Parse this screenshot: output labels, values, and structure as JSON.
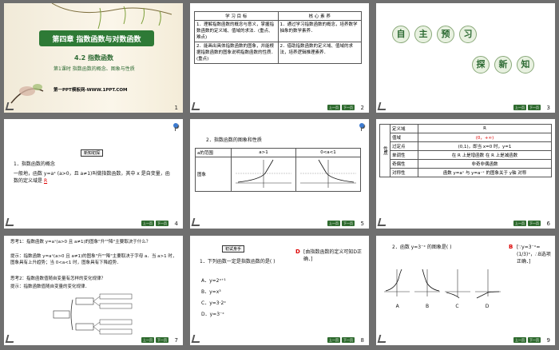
{
  "slide1": {
    "chapter_title": "第四章  指数函数与对数函数",
    "section": "4.2  指数函数",
    "lesson": "第1课时  指数函数的概念、图象与性质",
    "website": "第一PPT模板网-WWW.1PPT.COM",
    "number": "1"
  },
  "slide2": {
    "header_goal": "学 习 目 标",
    "header_core": "核 心 素 养",
    "row1_goal": "1．理解指数函数的概念与意义，掌握指数函数的定义域、值域的求法．(重点、难点)",
    "row1_core": "1．通过学习指数函数的概念，培养数学抽象的数学素养．",
    "row2_goal": "2．能画出具体指数函数的图象，并能根据指数函数的图象说明指数函数的性质．(重点)",
    "row2_core": "2．借助指数函数的定义域、值域的求法，培养逻辑推理素养．",
    "number": "2"
  },
  "slide3": {
    "chars1": [
      "自",
      "主",
      "预",
      "习"
    ],
    "chars2": [
      "探",
      "新",
      "知"
    ],
    "number": "3"
  },
  "slide4": {
    "tag": "新知初探",
    "heading": "1．指数函数的概念",
    "body": "一般地，函数 y=aˣ (a>0，且 a≠1)叫做指数函数，其中 x 是自变量，函数的定义域是",
    "answer": "R",
    "number": "4"
  },
  "slide5": {
    "heading": "2．指数函数的图象和性质",
    "col_range": "a的范围",
    "col_a_gt_1": "a>1",
    "col_a_lt_1": "0<a<1",
    "row_graph": "图象",
    "number": "5"
  },
  "slide6": {
    "side_label": "性质",
    "rows": [
      {
        "label": "定义域",
        "value": "R"
      },
      {
        "label": "值域",
        "value": "(0，+∞)"
      },
      {
        "label": "过定点",
        "value": "(0,1)，即当 x=0 时，y=1"
      },
      {
        "label": "单调性",
        "value": "在 R 上是增函数      在 R 上是减函数"
      },
      {
        "label": "奇偶性",
        "value": "非奇非偶函数"
      },
      {
        "label": "对称性",
        "value": "函数 y=aˣ 与 y=a⁻ˣ 的图象关于 y轴 对称"
      }
    ],
    "number": "6"
  },
  "slide7": {
    "think1": "思考1：指数函数 y=aˣ(a>0 且 a≠1)的图象\"升\"\"降\"主要取决于什么？",
    "hint1": "提示：指数函数 y=aˣ(a>0 且 a≠1)的图象\"升\"\"降\"主要取决于字母 a．当 a>1 时，图象具有上升趋势；当 0<a<1 时，图象具有下降趋势．",
    "think2": "思考2：指数函数值随自变量有怎样的变化规律？",
    "hint2": "提示：指数函数值随自变量的变化规律．",
    "number": "7"
  },
  "slide8": {
    "tag": "初试身手",
    "question": "1．下列函数一定是指数函数的是(    )",
    "options": [
      "A．y=2ˣ⁺¹",
      "B．y=x³",
      "C．y=3·2ˣ",
      "D．y=3⁻ˣ"
    ],
    "answer_letter": "D",
    "answer_text": "[由指数函数的定义可知D正确．]",
    "number": "8"
  },
  "slide9": {
    "question": "2．函数 y=3⁻ˣ 的图象是(    )",
    "options": [
      "A",
      "B",
      "C",
      "D"
    ],
    "answer_letter": "B",
    "answer_text": "[∵y=3⁻ˣ=(1/3)ˣ，∴B选项正确．]",
    "number": "9"
  },
  "nav": {
    "prev": "上一页",
    "next": "下一页"
  }
}
